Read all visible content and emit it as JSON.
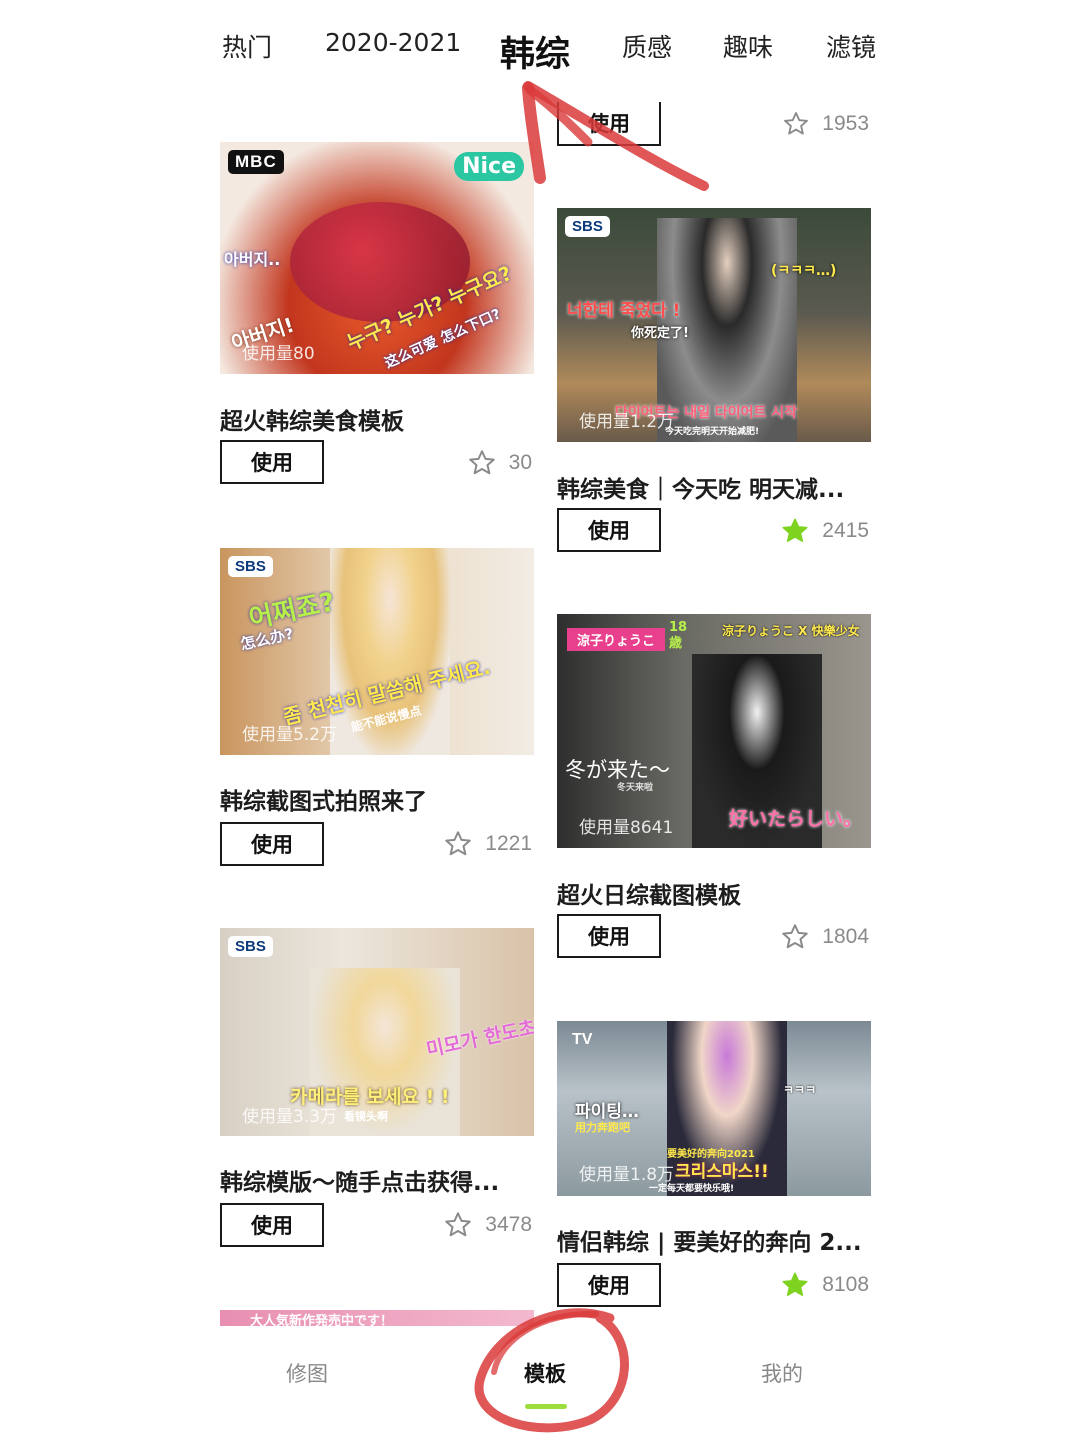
{
  "top_tabs": [
    {
      "label": "热门",
      "active": false
    },
    {
      "label": "2020-2021",
      "active": false
    },
    {
      "label": "韩综",
      "active": true
    },
    {
      "label": "质感",
      "active": false
    },
    {
      "label": "趣味",
      "active": false
    },
    {
      "label": "滤镜",
      "active": false
    }
  ],
  "partial_top": {
    "use_label": "使用",
    "count": "1953",
    "favorited": false
  },
  "left_column": [
    {
      "logo": "MBC",
      "usage": "使用量80",
      "overlay": [
        "Nice",
        "아버지..",
        "누구? 누가? 누구요?",
        "这么可爱 怎么下口?",
        "아버지!"
      ],
      "title": "超火韩综美食模板",
      "use_label": "使用",
      "count": "30",
      "favorited": false
    },
    {
      "logo": "SBS",
      "usage": "使用量5.2万",
      "overlay": [
        "어쩌죠?",
        "怎么办?",
        "좀 천천히 말씀해 주세요.",
        "能不能说慢点"
      ],
      "title": "韩综截图式拍照来了",
      "use_label": "使用",
      "count": "1221",
      "favorited": false
    },
    {
      "logo": "SBS",
      "usage": "使用量3.3万",
      "overlay": [
        "미모가 한도초과",
        "카메라를 보세요 ! !",
        "看镜头啊"
      ],
      "title": "韩综模版～随手点击获得...",
      "use_label": "使用",
      "count": "3478",
      "favorited": false
    }
  ],
  "right_column": [
    {
      "logo": "SBS",
      "usage": "使用量1.2万",
      "overlay": [
        "(ㅋㅋㅋ…)",
        "너한테 죽었다 !",
        "你死定了!",
        "다이어트는 내일 다이어트 시작",
        "今天吃完明天开始减肥!"
      ],
      "title": "韩综美食｜今天吃 明天减...",
      "use_label": "使用",
      "count": "2415",
      "favorited": true
    },
    {
      "logo": "",
      "usage": "使用量8641",
      "overlay": [
        "涼子りょうこ",
        "18歳",
        "涼子りょうこ X 快樂少女",
        "冬が来た～",
        "冬天来啦",
        "好いたらしい。"
      ],
      "title": "超火日综截图模板",
      "use_label": "使用",
      "count": "1804",
      "favorited": false
    },
    {
      "logo": "TV",
      "usage": "使用量1.8万",
      "overlay": [
        "파이팅…",
        "用力奔跑吧",
        "ㅋㅋㅋ",
        "要美好的奔向2021",
        "크리스마스!!",
        "一定每天都要快乐哦!"
      ],
      "title": "情侣韩综 | 要美好的奔向 2...",
      "use_label": "使用",
      "count": "8108",
      "favorited": true
    }
  ],
  "bottom_peek_text": "大人気新作発売中です！",
  "bottom_nav": [
    {
      "label": "修图",
      "active": false
    },
    {
      "label": "模板",
      "active": true
    },
    {
      "label": "我的",
      "active": false
    }
  ],
  "colors": {
    "favorited_star": "#7ed321",
    "nav_indicator": "#9bdd3c",
    "annotation_red": "#d93a3a"
  },
  "icons": {
    "star_outline": "star-outline-icon",
    "star_filled": "star-filled-icon"
  }
}
